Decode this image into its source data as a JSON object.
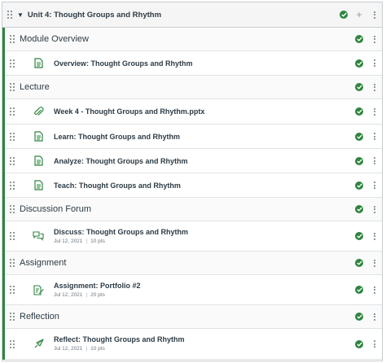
{
  "module": {
    "title": "Unit 4: Thought Groups and Rhythm",
    "rows": [
      {
        "kind": "header",
        "label": "Module Overview",
        "published": true
      },
      {
        "kind": "item",
        "icon": "page-icon",
        "label": "Overview: Thought Groups and Rhythm",
        "published": true
      },
      {
        "kind": "header",
        "label": "Lecture",
        "published": true
      },
      {
        "kind": "item",
        "icon": "attachment-icon",
        "label": "Week 4 - Thought Groups and Rhythm.pptx",
        "published": true
      },
      {
        "kind": "item",
        "icon": "page-icon",
        "label": "Learn: Thought Groups and Rhythm",
        "published": true
      },
      {
        "kind": "item",
        "icon": "page-icon",
        "label": "Analyze: Thought Groups and Rhythm",
        "published": true
      },
      {
        "kind": "item",
        "icon": "page-icon",
        "label": "Teach: Thought Groups and Rhythm",
        "published": true
      },
      {
        "kind": "header",
        "label": "Discussion Forum",
        "published": true
      },
      {
        "kind": "item",
        "icon": "discussion-icon",
        "label": "Discuss: Thought Groups and Rhythm",
        "date": "Jul 12, 2021",
        "points": "10 pts",
        "published": true
      },
      {
        "kind": "header",
        "label": "Assignment",
        "published": true
      },
      {
        "kind": "item",
        "icon": "assignment-icon",
        "label": "Assignment: Portfolio #2",
        "date": "Jul 12, 2021",
        "points": "20 pts",
        "published": true
      },
      {
        "kind": "header",
        "label": "Reflection",
        "published": true
      },
      {
        "kind": "item",
        "icon": "quiz-icon",
        "label": "Reflect: Thought Groups and Rhythm",
        "date": "Jul 12, 2021",
        "points": "10 pts",
        "published": true
      }
    ]
  },
  "colors": {
    "published": "#2e8540",
    "text": "#2d3b45",
    "muted": "#6b7780",
    "border": "#c7cdd1"
  }
}
